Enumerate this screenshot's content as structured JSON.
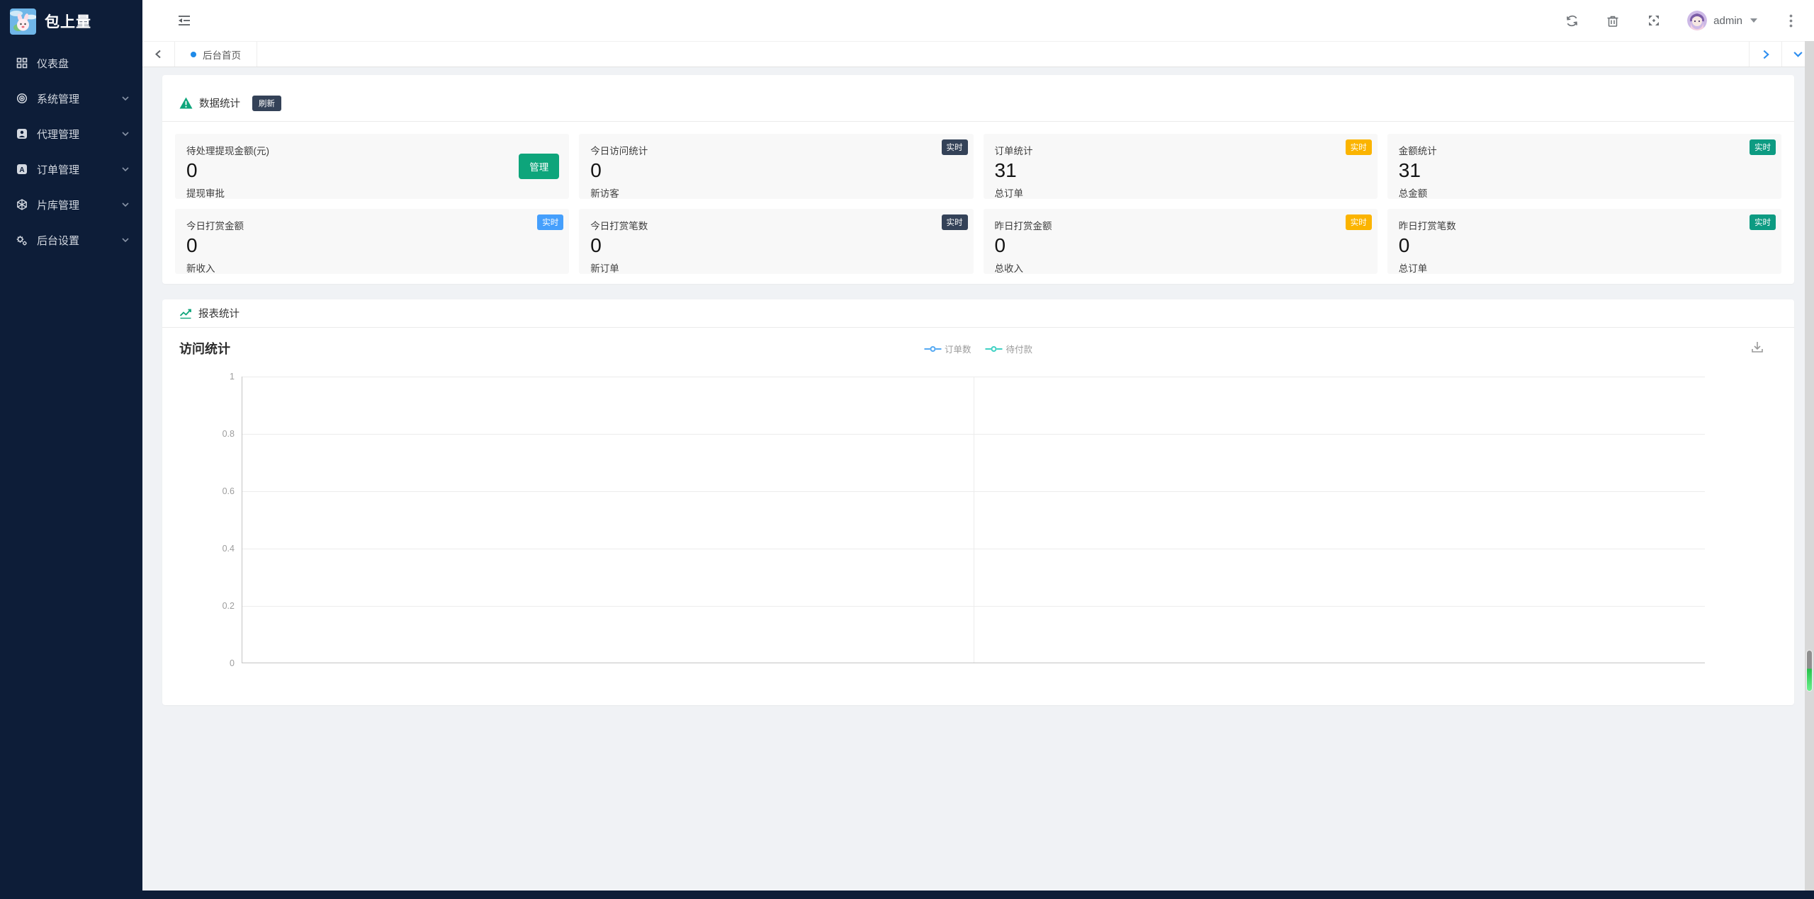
{
  "app": {
    "title": "包上量"
  },
  "sidebar": {
    "items": [
      {
        "label": "仪表盘"
      },
      {
        "label": "系统管理"
      },
      {
        "label": "代理管理"
      },
      {
        "label": "订单管理"
      },
      {
        "label": "片库管理"
      },
      {
        "label": "后台设置"
      }
    ]
  },
  "header": {
    "user": "admin"
  },
  "tabs": {
    "active": "后台首页"
  },
  "stats": {
    "title": "数据统计",
    "refresh_badge": "刷新",
    "cards": [
      {
        "label": "待处理提现金额(元)",
        "value": "0",
        "sub": "提现审批",
        "button": "管理",
        "button_color": "#0ea57b"
      },
      {
        "label": "今日访问统计",
        "value": "0",
        "sub": "新访客",
        "badge": "实时",
        "badge_color": "#344258"
      },
      {
        "label": "订单统计",
        "value": "31",
        "sub": "总订单",
        "badge": "实时",
        "badge_color": "#fbb400"
      },
      {
        "label": "金额统计",
        "value": "31",
        "sub": "总金额",
        "badge": "实时",
        "badge_color": "#0d9b82"
      },
      {
        "label": "今日打赏金额",
        "value": "0",
        "sub": "新收入",
        "badge": "实时",
        "badge_color": "#459ffc"
      },
      {
        "label": "今日打赏笔数",
        "value": "0",
        "sub": "新订单",
        "badge": "实时",
        "badge_color": "#344258"
      },
      {
        "label": "昨日打赏金额",
        "value": "0",
        "sub": "总收入",
        "badge": "实时",
        "badge_color": "#fbb400"
      },
      {
        "label": "昨日打赏笔数",
        "value": "0",
        "sub": "总订单",
        "badge": "实时",
        "badge_color": "#0d9b82"
      }
    ]
  },
  "report": {
    "title": "报表统计"
  },
  "chart_data": {
    "type": "line",
    "title": "访问统计",
    "series": [
      {
        "name": "订单数",
        "color": "#55a9f2",
        "values": []
      },
      {
        "name": "待付款",
        "color": "#3fd1c3",
        "values": []
      }
    ],
    "x": [],
    "ylim": [
      0,
      1
    ],
    "yticks": [
      "1",
      "0.8",
      "0.6",
      "0.4",
      "0.2",
      "0"
    ],
    "grid": true,
    "legend_position": "top-center"
  }
}
